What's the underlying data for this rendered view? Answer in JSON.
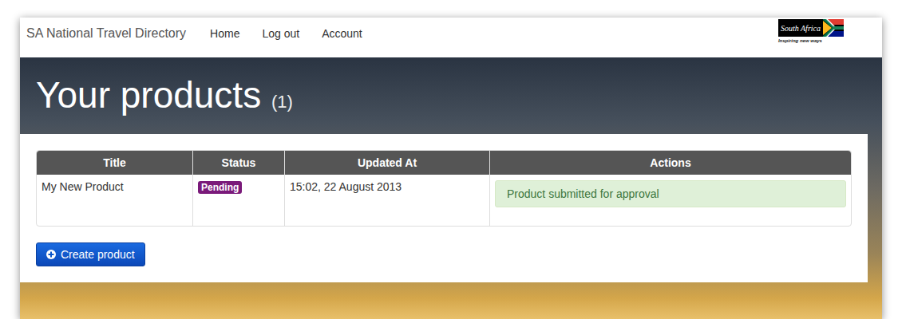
{
  "nav": {
    "brand": "SA National Travel Directory",
    "links": [
      "Home",
      "Log out",
      "Account"
    ]
  },
  "logo": {
    "title": "South Africa",
    "tagline": "Inspiring new ways"
  },
  "page": {
    "title": "Your products",
    "count": "(1)"
  },
  "table": {
    "columns": [
      "Title",
      "Status",
      "Updated At",
      "Actions"
    ],
    "rows": [
      {
        "title": "My New Product",
        "status": "Pending",
        "updated_at": "15:02, 22 August 2013",
        "action": "Product submitted for approval"
      }
    ]
  },
  "buttons": [
    "Create product"
  ]
}
